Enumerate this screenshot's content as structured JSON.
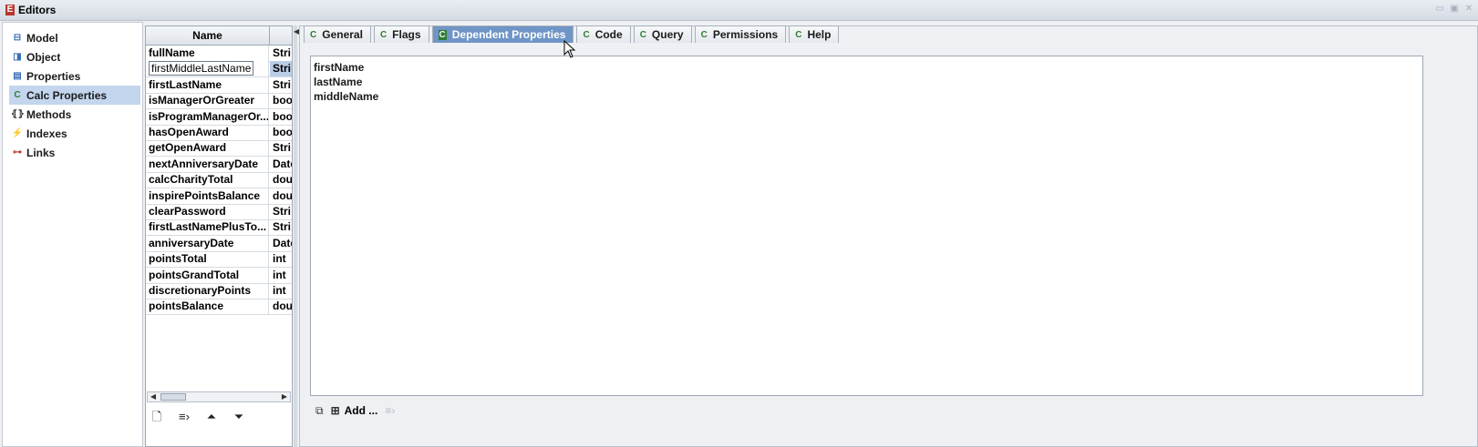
{
  "window": {
    "title": "Editors",
    "app_icon": "E"
  },
  "sidebar": {
    "items": [
      {
        "label": "Model",
        "icon": "model-icon",
        "selected": false
      },
      {
        "label": "Object",
        "icon": "object-icon",
        "selected": false
      },
      {
        "label": "Properties",
        "icon": "properties-icon",
        "selected": false
      },
      {
        "label": "Calc Properties",
        "icon": "calc-properties-icon",
        "selected": true
      },
      {
        "label": "Methods",
        "icon": "methods-icon",
        "selected": false
      },
      {
        "label": "Indexes",
        "icon": "indexes-icon",
        "selected": false
      },
      {
        "label": "Links",
        "icon": "links-icon",
        "selected": false
      }
    ]
  },
  "grid": {
    "header_name": "Name",
    "rows": [
      {
        "name": "fullName",
        "type": "Stri"
      },
      {
        "name": "firstMiddleLastName",
        "type": "Stri"
      },
      {
        "name": "firstLastName",
        "type": "Stri"
      },
      {
        "name": "isManagerOrGreater",
        "type": "boo"
      },
      {
        "name": "isProgramManagerOr...",
        "type": "boo"
      },
      {
        "name": "hasOpenAward",
        "type": "boo"
      },
      {
        "name": "getOpenAward",
        "type": "Stri"
      },
      {
        "name": "nextAnniversaryDate",
        "type": "Date"
      },
      {
        "name": "calcCharityTotal",
        "type": "dou"
      },
      {
        "name": "inspirePointsBalance",
        "type": "dou"
      },
      {
        "name": "clearPassword",
        "type": "Stri"
      },
      {
        "name": "firstLastNamePlusTo...",
        "type": "Stri"
      },
      {
        "name": "anniversaryDate",
        "type": "Date"
      },
      {
        "name": "pointsTotal",
        "type": "int"
      },
      {
        "name": "pointsGrandTotal",
        "type": "int"
      },
      {
        "name": "discretionaryPoints",
        "type": "int"
      },
      {
        "name": "pointsBalance",
        "type": "dou"
      }
    ]
  },
  "tabs": [
    {
      "label": "General",
      "active": false
    },
    {
      "label": "Flags",
      "active": false
    },
    {
      "label": "Dependent Properties",
      "active": true
    },
    {
      "label": "Code",
      "active": false
    },
    {
      "label": "Query",
      "active": false
    },
    {
      "label": "Permissions",
      "active": false
    },
    {
      "label": "Help",
      "active": false
    }
  ],
  "dependent_properties": [
    "firstName",
    "lastName",
    "middleName"
  ],
  "bottom_toolbar": {
    "add_label": "Add ..."
  }
}
